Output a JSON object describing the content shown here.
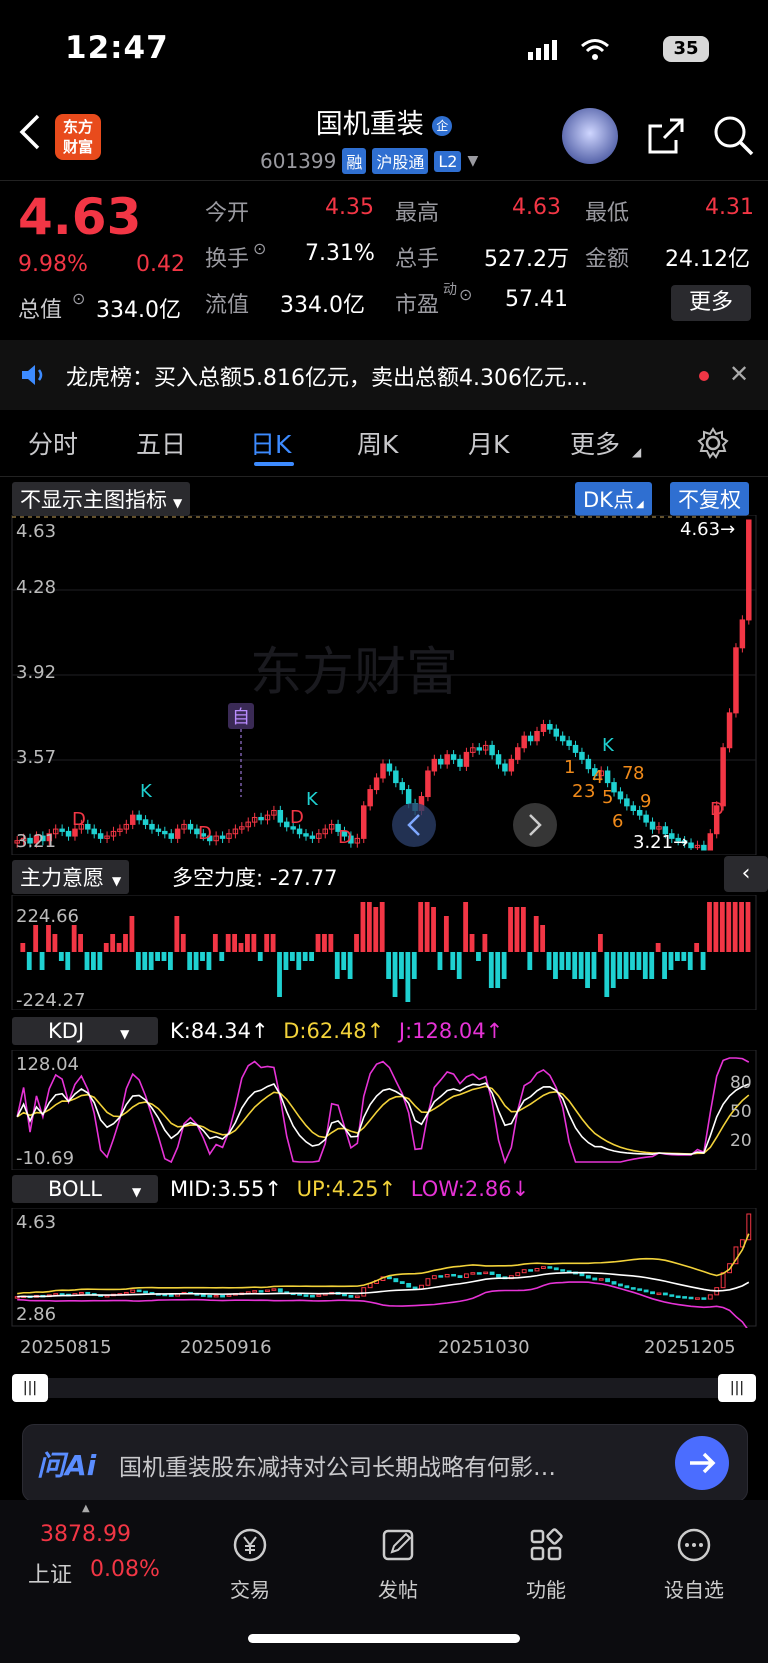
{
  "status": {
    "time": "12:47",
    "battery": "35"
  },
  "header": {
    "title": "国机重装",
    "badge": "企",
    "code": "601399",
    "tags": [
      "融",
      "沪股通",
      "L2"
    ],
    "logo_line1": "东方",
    "logo_line2": "财富"
  },
  "quote": {
    "price": "4.63",
    "change_pct": "9.98%",
    "change_abs": "0.42",
    "fields": [
      {
        "label": "今开",
        "value": "4.35"
      },
      {
        "label": "最高",
        "value": "4.63"
      },
      {
        "label": "最低",
        "value": "4.31"
      },
      {
        "label": "换手",
        "value": "7.31%"
      },
      {
        "label": "总手",
        "value": "527.2万"
      },
      {
        "label": "金额",
        "value": "24.12亿"
      },
      {
        "label": "总值",
        "value": "334.0亿"
      },
      {
        "label": "流值",
        "value": "334.0亿"
      },
      {
        "label": "市盈",
        "value": "57.41"
      }
    ],
    "pe_sup": "动",
    "more_label": "更多"
  },
  "news": {
    "text": "龙虎榜：买入总额5.816亿元，卖出总额4.306亿元…"
  },
  "tabs": [
    "分时",
    "五日",
    "日K",
    "周K",
    "月K",
    "更多"
  ],
  "active_tab": "日K",
  "chart_toolbar": {
    "indicator": "不显示主图指标",
    "dk": "DK点",
    "fq": "不复权"
  },
  "main_chart": {
    "y_labels": [
      "4.63",
      "4.28",
      "3.92",
      "3.57",
      "3.21"
    ],
    "last_label": "4.63→",
    "low_label": "3.21→",
    "watermark": "东方财富",
    "mark_zi": "自",
    "marks_K": [
      "K",
      "K",
      "K"
    ],
    "marks_D": [
      "D",
      "D",
      "D",
      "D",
      "D"
    ],
    "td_numbers": [
      "1",
      "2",
      "3",
      "4",
      "5",
      "6",
      "7",
      "8",
      "9"
    ]
  },
  "zlyy": {
    "name": "主力意愿",
    "label": "多空力度:",
    "value": "-27.77",
    "top": "224.66",
    "bottom": "-224.27"
  },
  "kdj": {
    "name": "KDJ",
    "k": "K:84.34↑",
    "d": "D:62.48↑",
    "j": "J:128.04↑",
    "top": "128.04",
    "bottom": "-10.69",
    "levels": [
      "80",
      "50",
      "20"
    ]
  },
  "boll": {
    "name": "BOLL",
    "mid": "MID:3.55↑",
    "up": "UP:4.25↑",
    "low": "LOW:2.86↓",
    "top": "4.63",
    "bottom": "2.86"
  },
  "dates": [
    "20250815",
    "20250916",
    "20251030",
    "20251205"
  ],
  "ai": {
    "logo": "问Ai",
    "prompt": "国机重装股东减持对公司长期战略有何影…"
  },
  "bottom_nav": {
    "index_value": "3878.99",
    "index_name": "上证",
    "index_change": "0.08%",
    "items": [
      "交易",
      "发帖",
      "功能",
      "设自选"
    ]
  },
  "colors": {
    "up": "#f23645",
    "down": "#1fd1d1",
    "accent": "#3d8bff",
    "k_line": "#ffffff",
    "d_line": "#f2d23a",
    "j_line": "#e633d6"
  },
  "chart_data": {
    "type": "candlestick",
    "ylim": [
      3.21,
      4.63
    ],
    "x_ticks": [
      "20250815",
      "20250916",
      "20251030",
      "20251205"
    ],
    "closes": [
      3.25,
      3.26,
      3.24,
      3.27,
      3.25,
      3.28,
      3.3,
      3.29,
      3.27,
      3.3,
      3.32,
      3.3,
      3.28,
      3.26,
      3.27,
      3.29,
      3.3,
      3.32,
      3.36,
      3.34,
      3.32,
      3.3,
      3.29,
      3.28,
      3.26,
      3.3,
      3.32,
      3.3,
      3.28,
      3.27,
      3.25,
      3.27,
      3.26,
      3.28,
      3.3,
      3.31,
      3.33,
      3.35,
      3.34,
      3.36,
      3.38,
      3.33,
      3.31,
      3.3,
      3.28,
      3.27,
      3.26,
      3.28,
      3.3,
      3.32,
      3.29,
      3.27,
      3.24,
      3.26,
      3.4,
      3.47,
      3.52,
      3.58,
      3.55,
      3.5,
      3.47,
      3.41,
      3.38,
      3.44,
      3.55,
      3.6,
      3.58,
      3.62,
      3.6,
      3.57,
      3.63,
      3.65,
      3.64,
      3.66,
      3.62,
      3.58,
      3.55,
      3.6,
      3.65,
      3.7,
      3.68,
      3.72,
      3.75,
      3.73,
      3.7,
      3.68,
      3.66,
      3.63,
      3.6,
      3.56,
      3.53,
      3.55,
      3.5,
      3.46,
      3.43,
      3.4,
      3.38,
      3.36,
      3.33,
      3.3,
      3.31,
      3.28,
      3.26,
      3.25,
      3.24,
      3.22,
      3.23,
      3.21,
      3.28,
      3.4,
      3.65,
      3.8,
      4.08,
      4.2,
      4.63
    ]
  }
}
